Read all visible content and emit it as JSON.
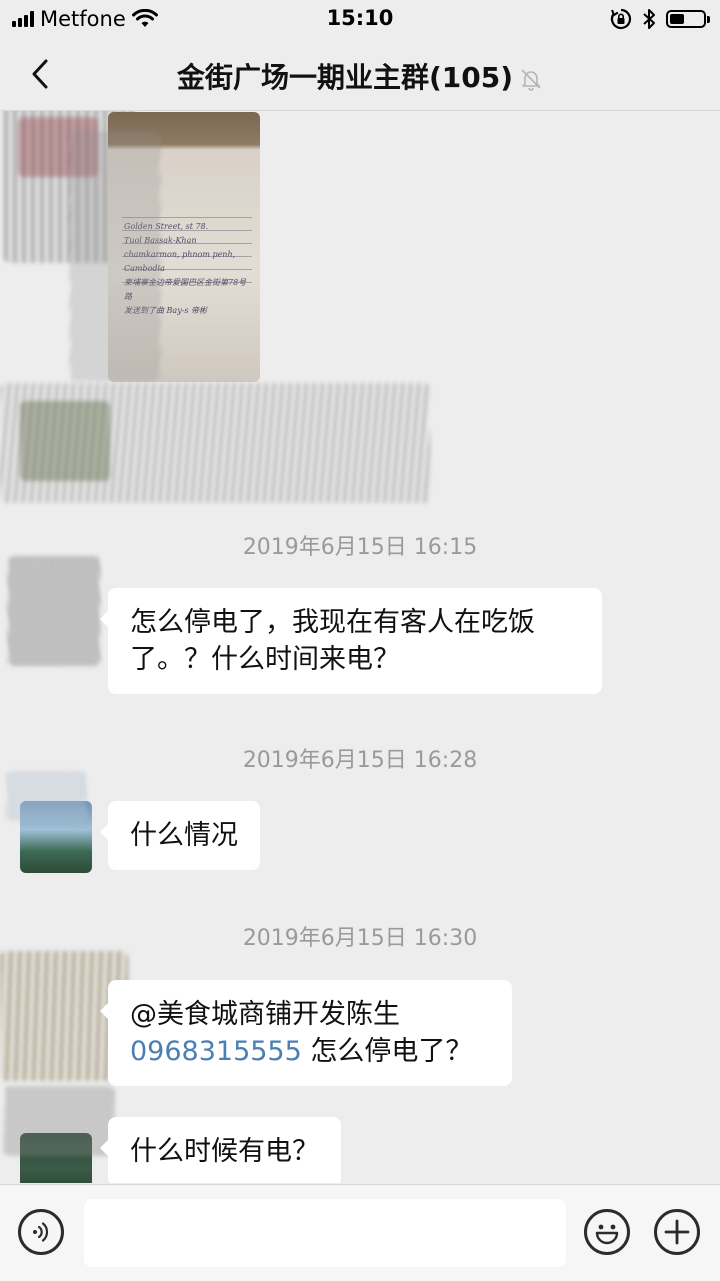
{
  "status_bar": {
    "carrier": "Metfone",
    "time": "15:10",
    "battery_level": 0.45
  },
  "nav": {
    "title": "金街广场一期业主群(105)",
    "muted": true
  },
  "photo": {
    "handwritten_text": "Golden Street, st 78.\nTuol Bassak-Khan\nchamkarmon, phnom penh, Cambodia\n柬埔寨金边帝爱国巴区金街第78号路\n发送到了曲 Bay-s 帝彬"
  },
  "messages": [
    {
      "timestamp": "2019年6月15日 16:15",
      "text": "怎么停电了，我现在有客人在吃饭了。？什么时间来电？"
    },
    {
      "timestamp": "2019年6月15日 16:28",
      "text": "什么情况"
    },
    {
      "timestamp": "2019年6月15日 16:30",
      "mention": "@美食城商铺开发陈生",
      "phone_link": "0968315555",
      "text": " 怎么停电了？"
    },
    {
      "text": "什么时候有电？"
    }
  ],
  "input": {
    "value": "",
    "placeholder": ""
  },
  "colors": {
    "background": "#ededed",
    "bubble": "#ffffff",
    "link": "#4a7fb5",
    "timestamp": "#9a9a9a"
  },
  "icons": [
    "signal-icon",
    "wifi-icon",
    "rotation-lock-icon",
    "bluetooth-icon",
    "battery-icon",
    "back-icon",
    "mute-bell-icon",
    "voice-icon",
    "emoji-icon",
    "plus-icon"
  ]
}
